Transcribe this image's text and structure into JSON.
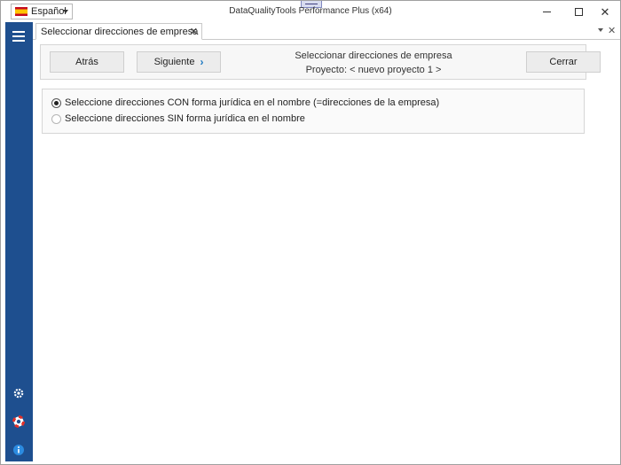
{
  "window": {
    "title": "DataQualityTools Performance Plus (x64)",
    "language": "Español"
  },
  "tab": {
    "label": "Seleccionar direcciones de empresa",
    "close": "✕"
  },
  "toolbar": {
    "back_label": "Atrás",
    "next_label": "Siguiente",
    "close_label": "Cerrar",
    "title": "Seleccionar direcciones de empresa",
    "project": "Proyecto: < nuevo proyecto 1 >"
  },
  "options": [
    {
      "label": "Seleccione direcciones CON forma jurídica en el nombre (=direcciones de la empresa)",
      "selected": true
    },
    {
      "label": "Seleccione direcciones SIN forma jurídica en el nombre",
      "selected": false
    }
  ],
  "colors": {
    "sidebar": "#1e4f8f",
    "accent": "#1a78c2"
  },
  "icons": {
    "menu": "hamburger-icon",
    "settings": "gear-icon",
    "help": "lifebuoy-icon",
    "info": "info-icon"
  }
}
